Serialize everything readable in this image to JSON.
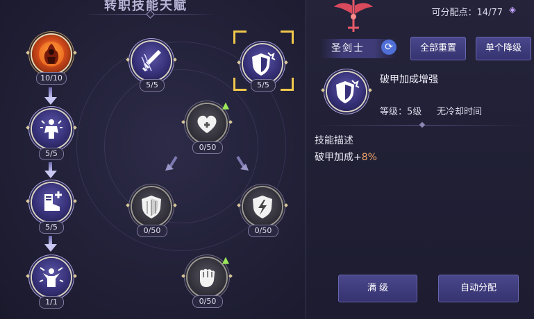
{
  "page": {
    "title": "转职技能天赋"
  },
  "points": {
    "label": "可分配点：",
    "value": "14/77",
    "icon": "crystal-icon"
  },
  "class": {
    "name": "圣剑士",
    "emblem_icon": "winged-sword-emblem-icon",
    "swap_icon": "swap-icon"
  },
  "buttons": {
    "reset_all": "全部重置",
    "downgrade_one": "单个降级",
    "max_level": "满 级",
    "auto_assign": "自动分配"
  },
  "selected_skill": {
    "name": "破甲加成增强",
    "level": "等级：5级",
    "cooldown": "无冷却时间",
    "desc_header": "技能描述",
    "desc_prefix": "破甲加成+",
    "desc_value": "8%",
    "value_color": "#f0a46a"
  },
  "tree": {
    "nodes": [
      {
        "id": "hero",
        "icon": "flaming-hero-icon",
        "level": "10/10"
      },
      {
        "id": "power-surge",
        "icon": "power-figure-icon",
        "level": "5/5"
      },
      {
        "id": "boots",
        "icon": "boots-plus-icon",
        "level": "5/5"
      },
      {
        "id": "burst",
        "icon": "burst-figure-icon",
        "level": "1/1"
      },
      {
        "id": "slash",
        "icon": "sword-slash-icon",
        "level": "5/5"
      },
      {
        "id": "armor-break",
        "icon": "shield-crack-icon",
        "level": "5/5"
      },
      {
        "id": "heart",
        "icon": "heart-plus-icon",
        "level": "0/50"
      },
      {
        "id": "shield",
        "icon": "shield-icon",
        "level": "0/50"
      },
      {
        "id": "shield-bolt",
        "icon": "shield-bolt-icon",
        "level": "0/50"
      },
      {
        "id": "fist",
        "icon": "fist-icon",
        "level": "0/50"
      }
    ],
    "upgrade_icon": "upgrade-arrow-icon",
    "selection_color": "#f1c84b"
  }
}
